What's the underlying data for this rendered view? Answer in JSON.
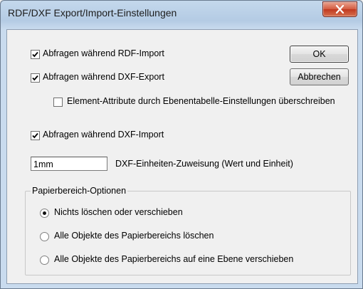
{
  "window": {
    "title": "RDF/DXF Export/Import-Einstellungen"
  },
  "buttons": {
    "ok": "OK",
    "cancel": "Abbrechen"
  },
  "options": {
    "rdf_import": {
      "label": "Abfragen während RDF-Import",
      "checked": true
    },
    "dxf_export": {
      "label": "Abfragen während DXF-Export",
      "checked": true
    },
    "overwrite_attrs": {
      "label": "Element-Attribute durch Ebenentabelle-Einstellungen überschreiben",
      "checked": false
    },
    "dxf_import": {
      "label": "Abfragen während DXF-Import",
      "checked": true
    }
  },
  "units": {
    "value": "1mm",
    "label": "DXF-Einheiten-Zuweisung (Wert und Einheit)"
  },
  "paper_group": {
    "title": "Papierbereich-Optionen",
    "options": [
      {
        "label": "Nichts löschen oder verschieben",
        "selected": true
      },
      {
        "label": "Alle Objekte des Papierbereichs löschen",
        "selected": false
      },
      {
        "label": "Alle Objekte des Papierbereichs auf eine Ebene verschieben",
        "selected": false
      }
    ]
  }
}
